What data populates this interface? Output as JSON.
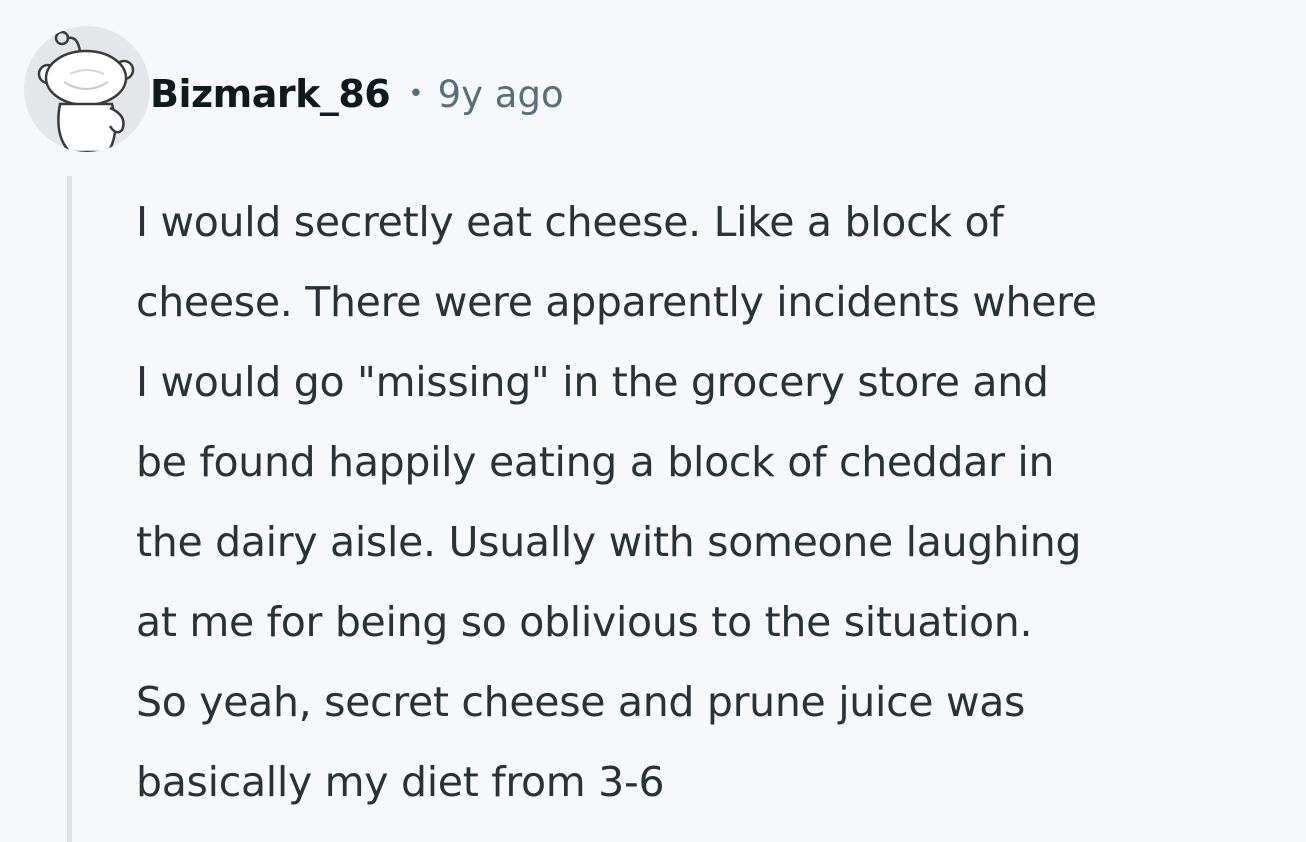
{
  "comment": {
    "author": "Bizmark_86",
    "separator": "•",
    "timestamp": "9y ago",
    "avatar_icon": "snoo-avatar-icon",
    "body_lines": [
      "I would secretly eat cheese. Like a block of",
      "cheese. There were apparently incidents where",
      "I would go \"missing\" in the grocery store and",
      "be found happily eating a block of cheddar in",
      "the dairy aisle. Usually with someone laughing",
      "at me for being so oblivious to the situation.",
      "So yeah, secret cheese and prune juice was",
      "basically my diet from 3-6"
    ]
  },
  "colors": {
    "background": "#f7f8fa",
    "username": "#0f1a1c",
    "meta": "#576f76",
    "body": "#2a3236",
    "thread_line": "#dfe3e6",
    "avatar_bg": "#e4e6e9"
  }
}
